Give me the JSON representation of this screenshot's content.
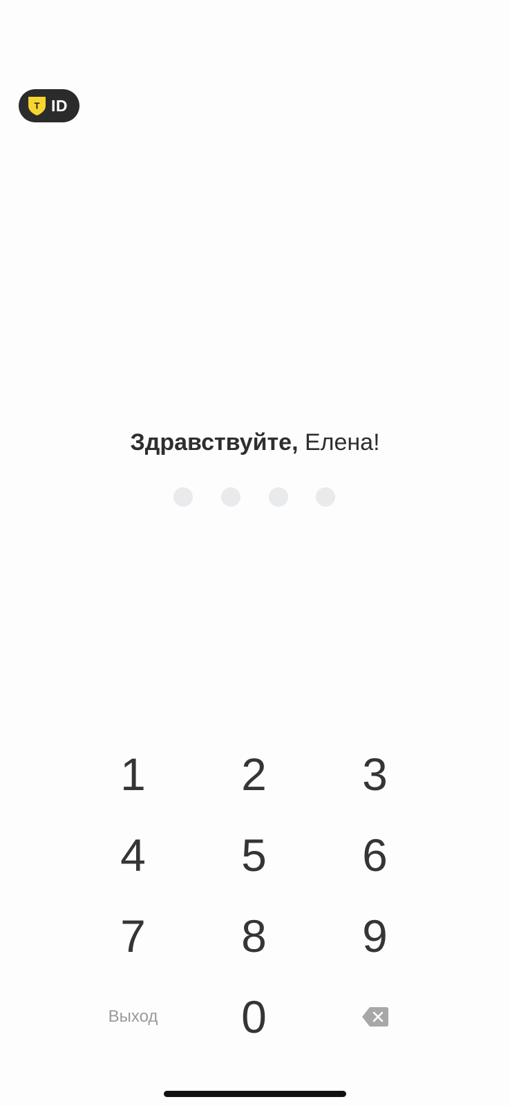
{
  "header": {
    "badge_icon": "shield-t-icon",
    "badge_shield_letter": "T",
    "badge_text": "ID",
    "colors": {
      "badge_bg": "#2b2b2b",
      "shield": "#f7d530"
    }
  },
  "greeting": {
    "hello": "Здравствуйте,",
    "name": "Елена!"
  },
  "pin": {
    "length": 4,
    "entered": 0,
    "dot_color": "#e9eaeb"
  },
  "keypad": {
    "keys": [
      "1",
      "2",
      "3",
      "4",
      "5",
      "6",
      "7",
      "8",
      "9"
    ],
    "exit_label": "Выход",
    "zero": "0",
    "backspace_icon": "backspace-icon"
  }
}
